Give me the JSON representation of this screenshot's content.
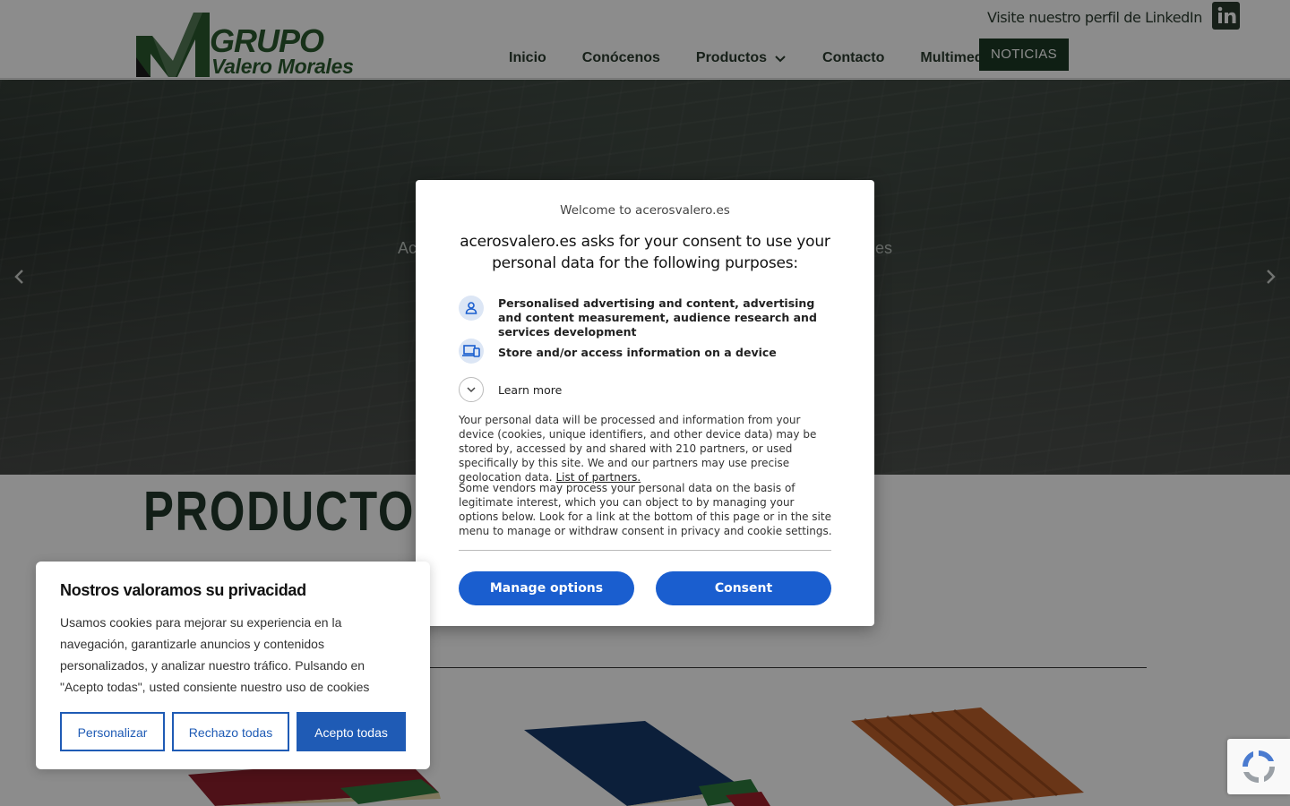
{
  "header": {
    "logo": {
      "line1": "GRUPO",
      "line2": "Valero Morales"
    },
    "linkedin_text": "Visite nuestro perfil de LinkedIn",
    "linkedin_icon": "linkedin-icon",
    "nav": {
      "inicio": "Inicio",
      "conocenos": "Conócenos",
      "productos": "Productos",
      "contacto": "Contacto",
      "multimedia": "Multimedia",
      "noticias": "NOTICIAS"
    }
  },
  "hero": {
    "subtitle_left": "Ac",
    "subtitle_right": "nes",
    "prev_icon": "chevron-left-icon",
    "next_icon": "chevron-right-icon"
  },
  "main": {
    "products_title": "PRODUCTOS"
  },
  "consent_modal": {
    "welcome": "Welcome to acerosvalero.es",
    "heading": "acerosvalero.es asks for your consent to use your personal data for the following purposes:",
    "purposes": [
      {
        "icon": "person-icon",
        "text": "Personalised advertising and content, advertising and content measurement, audience research and services development"
      },
      {
        "icon": "devices-icon",
        "text": "Store and/or access information on a device"
      }
    ],
    "learn_more": "Learn more",
    "paragraph1": "Your personal data will be processed and information from your device (cookies, unique identifiers, and other device data) may be stored by, accessed by and shared with 210 partners, or used specifically by this site. We and our partners may use precise geolocation data.",
    "partners_link": "List of partners.",
    "paragraph2": "Some vendors may process your personal data on the basis of legitimate interest, which you can object to by managing your options below. Look for a link at the bottom of this page or in the site menu to manage or withdraw consent in privacy and cookie settings.",
    "manage_button": "Manage options",
    "consent_button": "Consent"
  },
  "privacy_banner": {
    "title": "Nostros valoramos su privacidad",
    "text": "Usamos cookies para mejorar su experiencia en la navegación, garantizarle anuncios y contenidos personalizados, y analizar nuestro tráfico. Pulsando en \"Acepto todas\", usted consiente nuestro uso de cookies",
    "customize": "Personalizar",
    "reject": "Rechazo todas",
    "accept": "Acepto todas"
  },
  "colors": {
    "brand_green": "#2b5a2f",
    "nav_dark": "#1d3a26",
    "consent_blue": "#1a5ecf",
    "privacy_blue": "#1f5bb5"
  }
}
